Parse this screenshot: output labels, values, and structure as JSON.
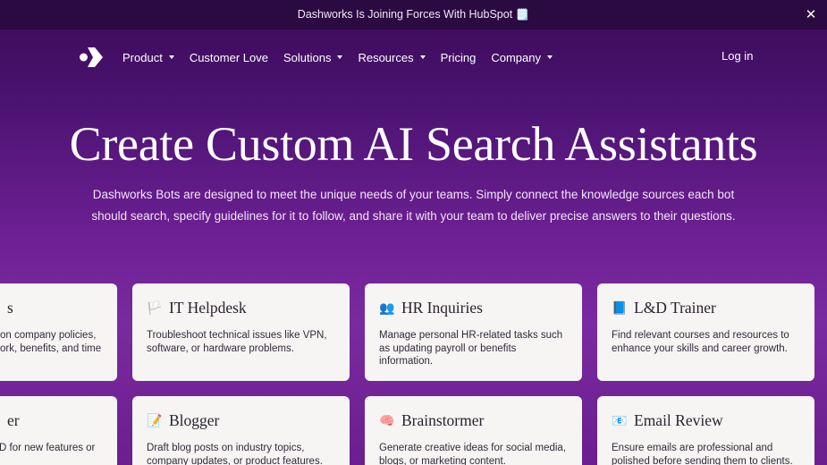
{
  "announcement": {
    "text": "Dashworks Is Joining Forces With HubSpot 🗒️",
    "close_icon": "close-icon"
  },
  "nav": {
    "logo_icon": "dashworks-logo-icon",
    "items": [
      {
        "label": "Product",
        "dropdown": true
      },
      {
        "label": "Customer Love",
        "dropdown": false
      },
      {
        "label": "Solutions",
        "dropdown": true
      },
      {
        "label": "Resources",
        "dropdown": true
      },
      {
        "label": "Pricing",
        "dropdown": false
      },
      {
        "label": "Company",
        "dropdown": true
      }
    ],
    "login": "Log in"
  },
  "hero": {
    "title": "Create Custom AI Search Assistants",
    "subtitle": "Dashworks Bots are designed to meet the unique needs of your teams. Simply connect the knowledge sources each bot should search, specify guidelines for it to follow, and share it with your team to deliver precise answers to their questions."
  },
  "cards_row1": [
    {
      "icon": "",
      "title": "s",
      "desc": "on company policies, ork, benefits, and time"
    },
    {
      "icon": "🏳️",
      "title": "IT Helpdesk",
      "desc": "Troubleshoot technical issues like VPN, software, or hardware problems."
    },
    {
      "icon": "👥",
      "title": "HR Inquiries",
      "desc": "Manage personal HR-related tasks such as updating payroll or benefits information."
    },
    {
      "icon": "📘",
      "title": "L&D Trainer",
      "desc": "Find relevant courses and resources to enhance your skills and career growth."
    }
  ],
  "cards_row2": [
    {
      "icon": "",
      "title": "er",
      "desc": "D for new features or"
    },
    {
      "icon": "📝",
      "title": "Blogger",
      "desc": "Draft blog posts on industry topics, company updates, or product features."
    },
    {
      "icon": "🧠",
      "title": "Brainstormer",
      "desc": "Generate creative ideas for social media, blogs, or marketing content."
    },
    {
      "icon": "📧",
      "title": "Email Review",
      "desc": "Ensure emails are professional and polished before sending them to clients."
    }
  ]
}
